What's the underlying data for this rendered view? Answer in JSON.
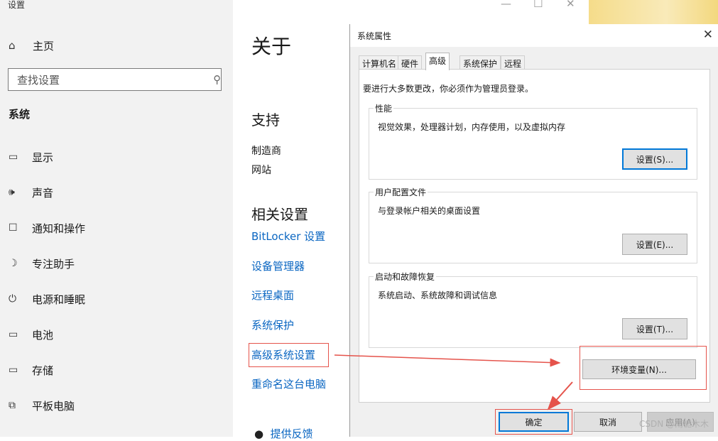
{
  "app_title": "设置",
  "nav": {
    "home_label": "主页",
    "search_placeholder": "查找设置",
    "section": "系统",
    "items": [
      {
        "label": "显示",
        "icon": "monitor-icon"
      },
      {
        "label": "声音",
        "icon": "speaker-icon"
      },
      {
        "label": "通知和操作",
        "icon": "notification-icon"
      },
      {
        "label": "专注助手",
        "icon": "moon-icon"
      },
      {
        "label": "电源和睡眠",
        "icon": "power-icon"
      },
      {
        "label": "电池",
        "icon": "battery-icon"
      },
      {
        "label": "存储",
        "icon": "storage-icon"
      },
      {
        "label": "平板电脑",
        "icon": "tablet-icon"
      }
    ]
  },
  "about": {
    "title": "关于",
    "support_title": "支持",
    "manufacturer": "制造商",
    "website": "网站",
    "related_title": "相关设置",
    "links": [
      "BitLocker 设置",
      "设备管理器",
      "远程桌面",
      "系统保护",
      "高级系统设置",
      "重命名这台电脑"
    ],
    "feedback": "提供反馈"
  },
  "dialog": {
    "title": "系统属性",
    "tabs": [
      "计算机名",
      "硬件",
      "高级",
      "系统保护",
      "远程"
    ],
    "active_tab": "高级",
    "notice": "要进行大多数更改，你必须作为管理员登录。",
    "groups": [
      {
        "title": "性能",
        "desc": "视觉效果，处理器计划，内存使用，以及虚拟内存",
        "button": "设置(S)..."
      },
      {
        "title": "用户配置文件",
        "desc": "与登录帐户相关的桌面设置",
        "button": "设置(E)..."
      },
      {
        "title": "启动和故障恢复",
        "desc": "系统启动、系统故障和调试信息",
        "button": "设置(T)..."
      }
    ],
    "env_button": "环境变量(N)...",
    "ok": "确定",
    "cancel": "取消",
    "apply": "应用(A)"
  },
  "watermark": "CSDN @南栀木木",
  "colors": {
    "annotation": "#e5534b",
    "link": "#0a66c2",
    "focus": "#0078d7"
  }
}
